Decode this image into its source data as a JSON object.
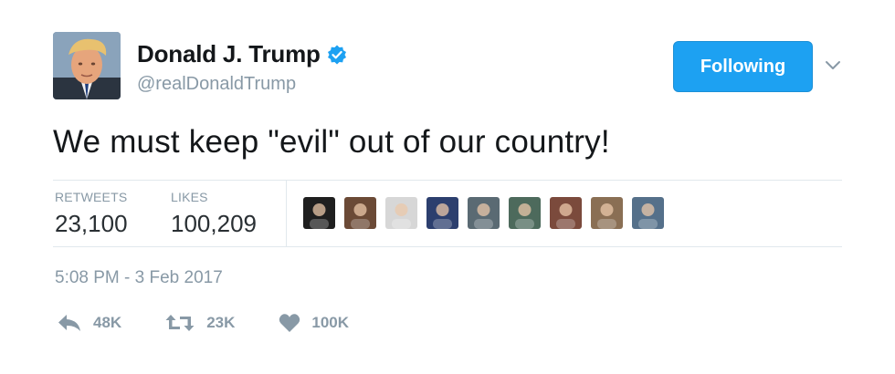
{
  "author": {
    "name": "Donald J. Trump",
    "handle": "@realDonaldTrump",
    "avatar_icon": "avatar-photo",
    "verified_icon": "verified-badge-icon"
  },
  "follow_button": {
    "label": "Following",
    "color": "#1da1f2"
  },
  "menu_icon": "chevron-down-icon",
  "tweet": {
    "text": "We must keep \"evil\" out of our country!"
  },
  "stats": {
    "retweets_label": "RETWEETS",
    "retweets_value": "23,100",
    "likes_label": "LIKES",
    "likes_value": "100,209"
  },
  "likers": [
    {
      "icon": "liker-avatar-1",
      "color": "#1f1f1f"
    },
    {
      "icon": "liker-avatar-2",
      "color": "#6b4a36"
    },
    {
      "icon": "liker-avatar-3",
      "color": "#d7d7d7"
    },
    {
      "icon": "liker-avatar-4",
      "color": "#2c3f6e"
    },
    {
      "icon": "liker-avatar-5",
      "color": "#5a6a73"
    },
    {
      "icon": "liker-avatar-6",
      "color": "#4d6a5c"
    },
    {
      "icon": "liker-avatar-7",
      "color": "#7b4a3c"
    },
    {
      "icon": "liker-avatar-8",
      "color": "#8a6f54"
    },
    {
      "icon": "liker-avatar-9",
      "color": "#55708a"
    }
  ],
  "timestamp": "5:08 PM - 3 Feb 2017",
  "actions": {
    "reply": {
      "icon": "reply-icon",
      "count": "48K"
    },
    "retweet": {
      "icon": "retweet-icon",
      "count": "23K"
    },
    "like": {
      "icon": "heart-icon",
      "count": "100K"
    }
  },
  "colors": {
    "muted": "#8899a6",
    "divider": "#e1e8ed",
    "text": "#14171a"
  }
}
